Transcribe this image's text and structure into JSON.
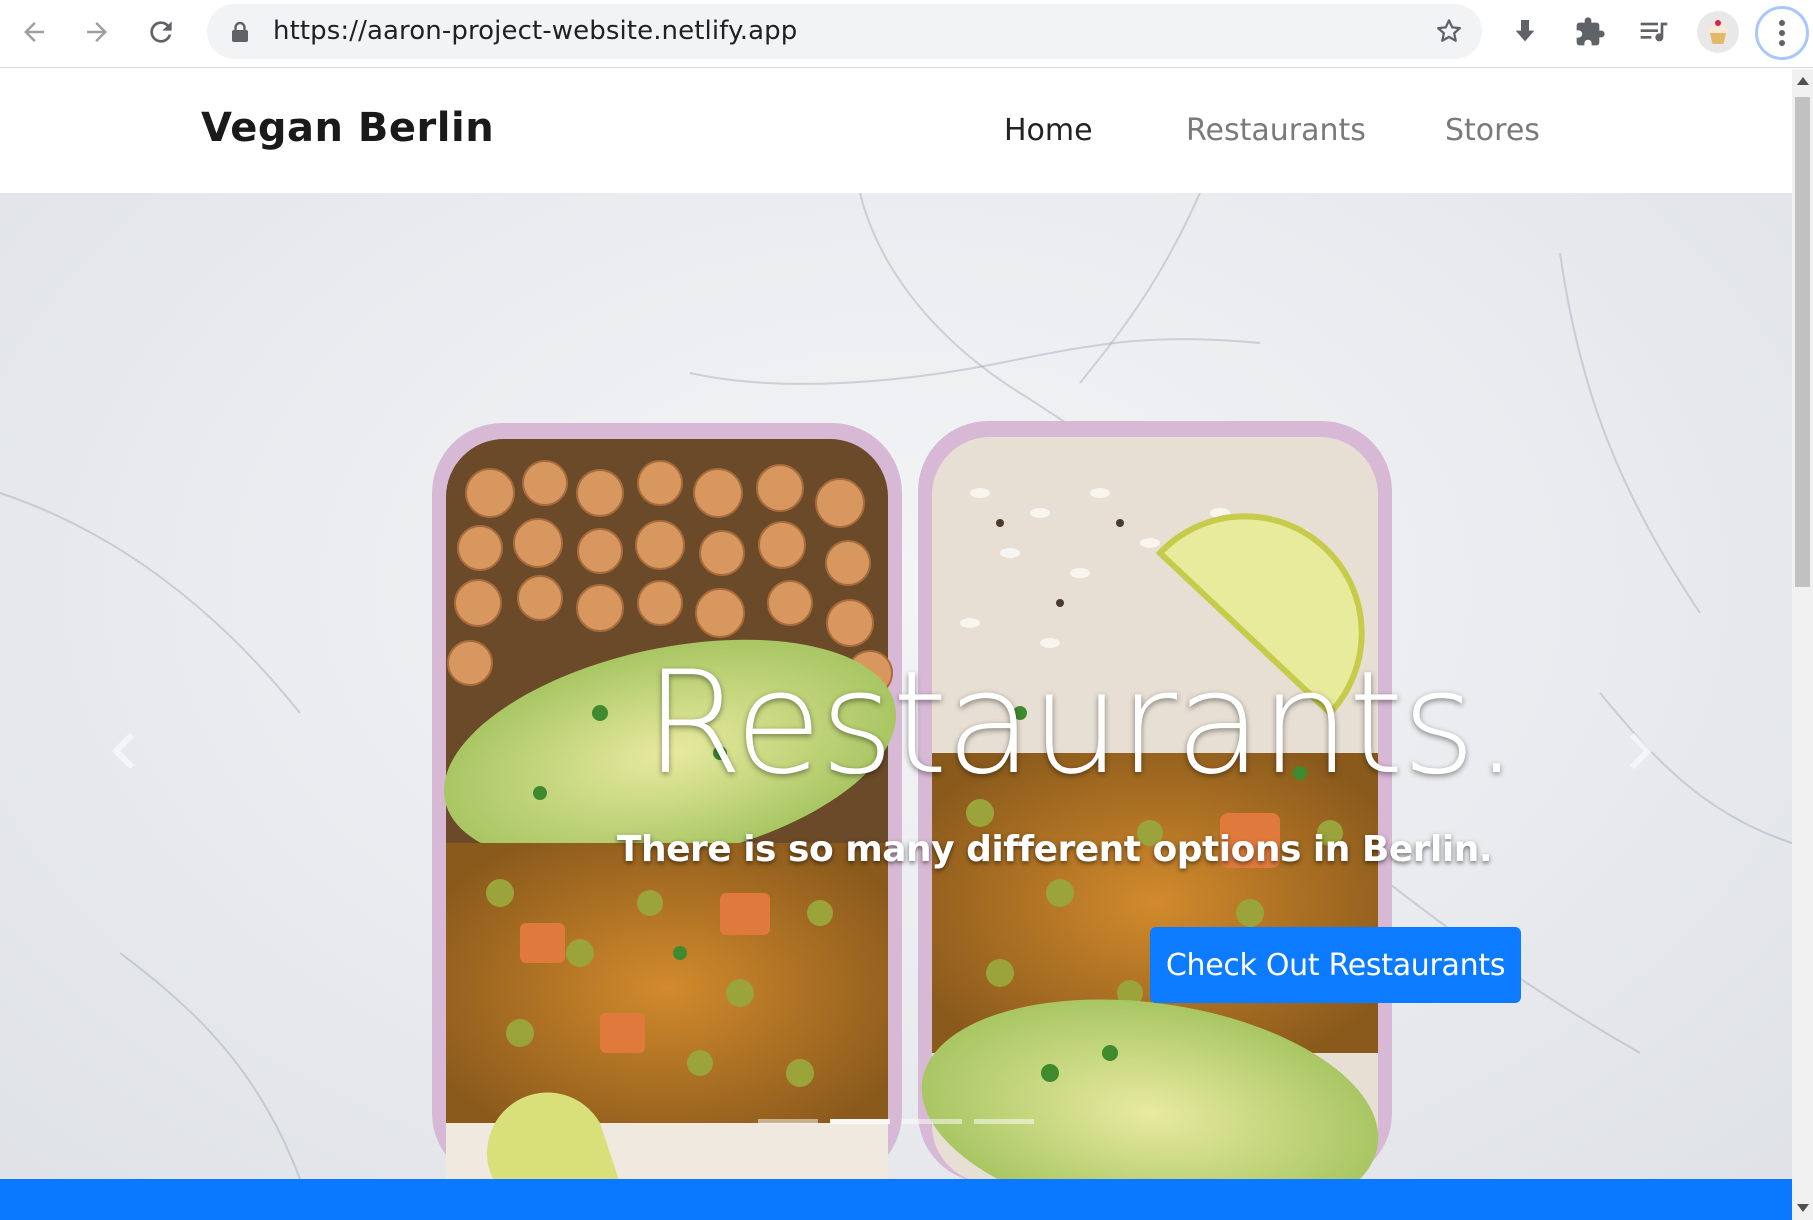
{
  "browser": {
    "url": "https://aaron-project-website.netlify.app",
    "icons": [
      "back-arrow-icon",
      "forward-arrow-icon",
      "reload-icon",
      "lock-icon",
      "bookmark-star-icon",
      "download-icon",
      "extensions-puzzle-icon",
      "media-queue-icon",
      "profile-cupcake-icon",
      "more-vertical-icon"
    ]
  },
  "site": {
    "brand": "Vegan Berlin",
    "nav": [
      {
        "label": "Home",
        "active": true
      },
      {
        "label": "Restaurants",
        "active": false
      },
      {
        "label": "Stores",
        "active": false
      }
    ]
  },
  "hero": {
    "title": "Restaurants.",
    "subtitle": "There is so many different options in Berlin.",
    "cta_label": "Check Out Restaurants",
    "slide_count": 4,
    "active_slide": 2
  },
  "colors": {
    "accent": "#0d7bff",
    "band": "#0a78ff"
  }
}
